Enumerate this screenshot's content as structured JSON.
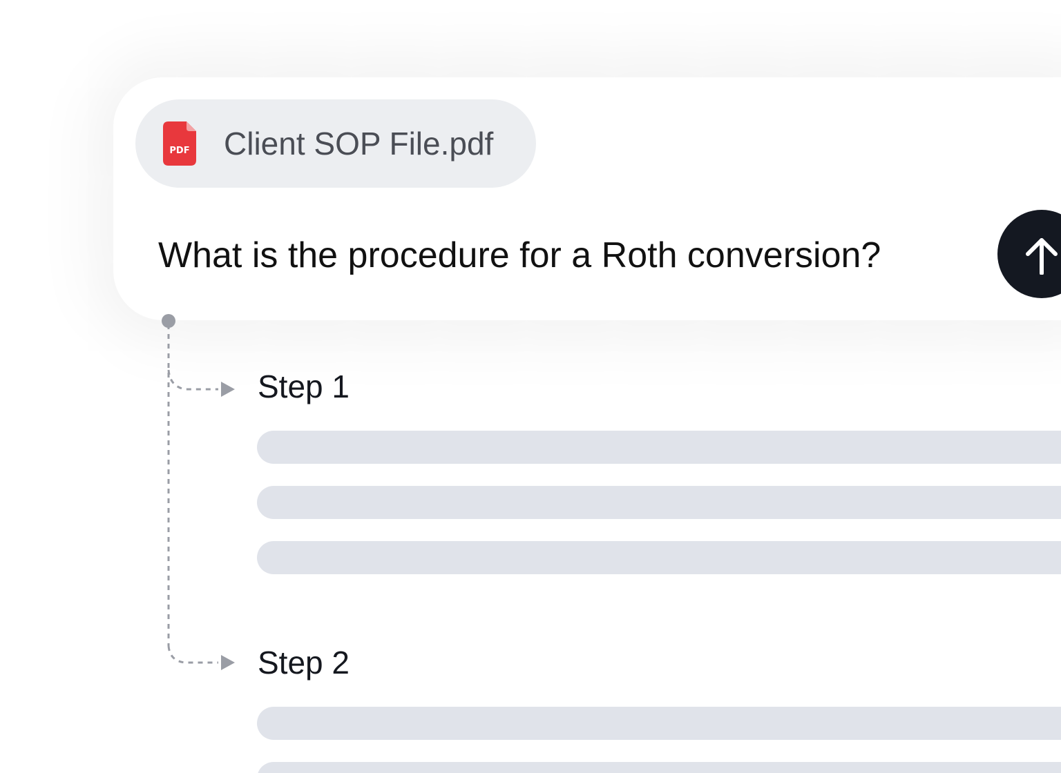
{
  "attachment": {
    "file_name": "Client SOP File.pdf",
    "icon": "pdf-file-icon",
    "icon_text": "PDF",
    "icon_color": "#e8383d"
  },
  "prompt": {
    "question": "What is the procedure for a Roth conversion?"
  },
  "send_button": {
    "icon": "arrow-up-icon",
    "color": "#141821"
  },
  "steps": [
    {
      "label": "Step 1",
      "placeholder_lines": 3
    },
    {
      "label": "Step 2",
      "placeholder_lines": 2
    }
  ],
  "colors": {
    "chip_background": "#eceef1",
    "skeleton": "#e0e3ea",
    "connector": "#9a9da5"
  }
}
